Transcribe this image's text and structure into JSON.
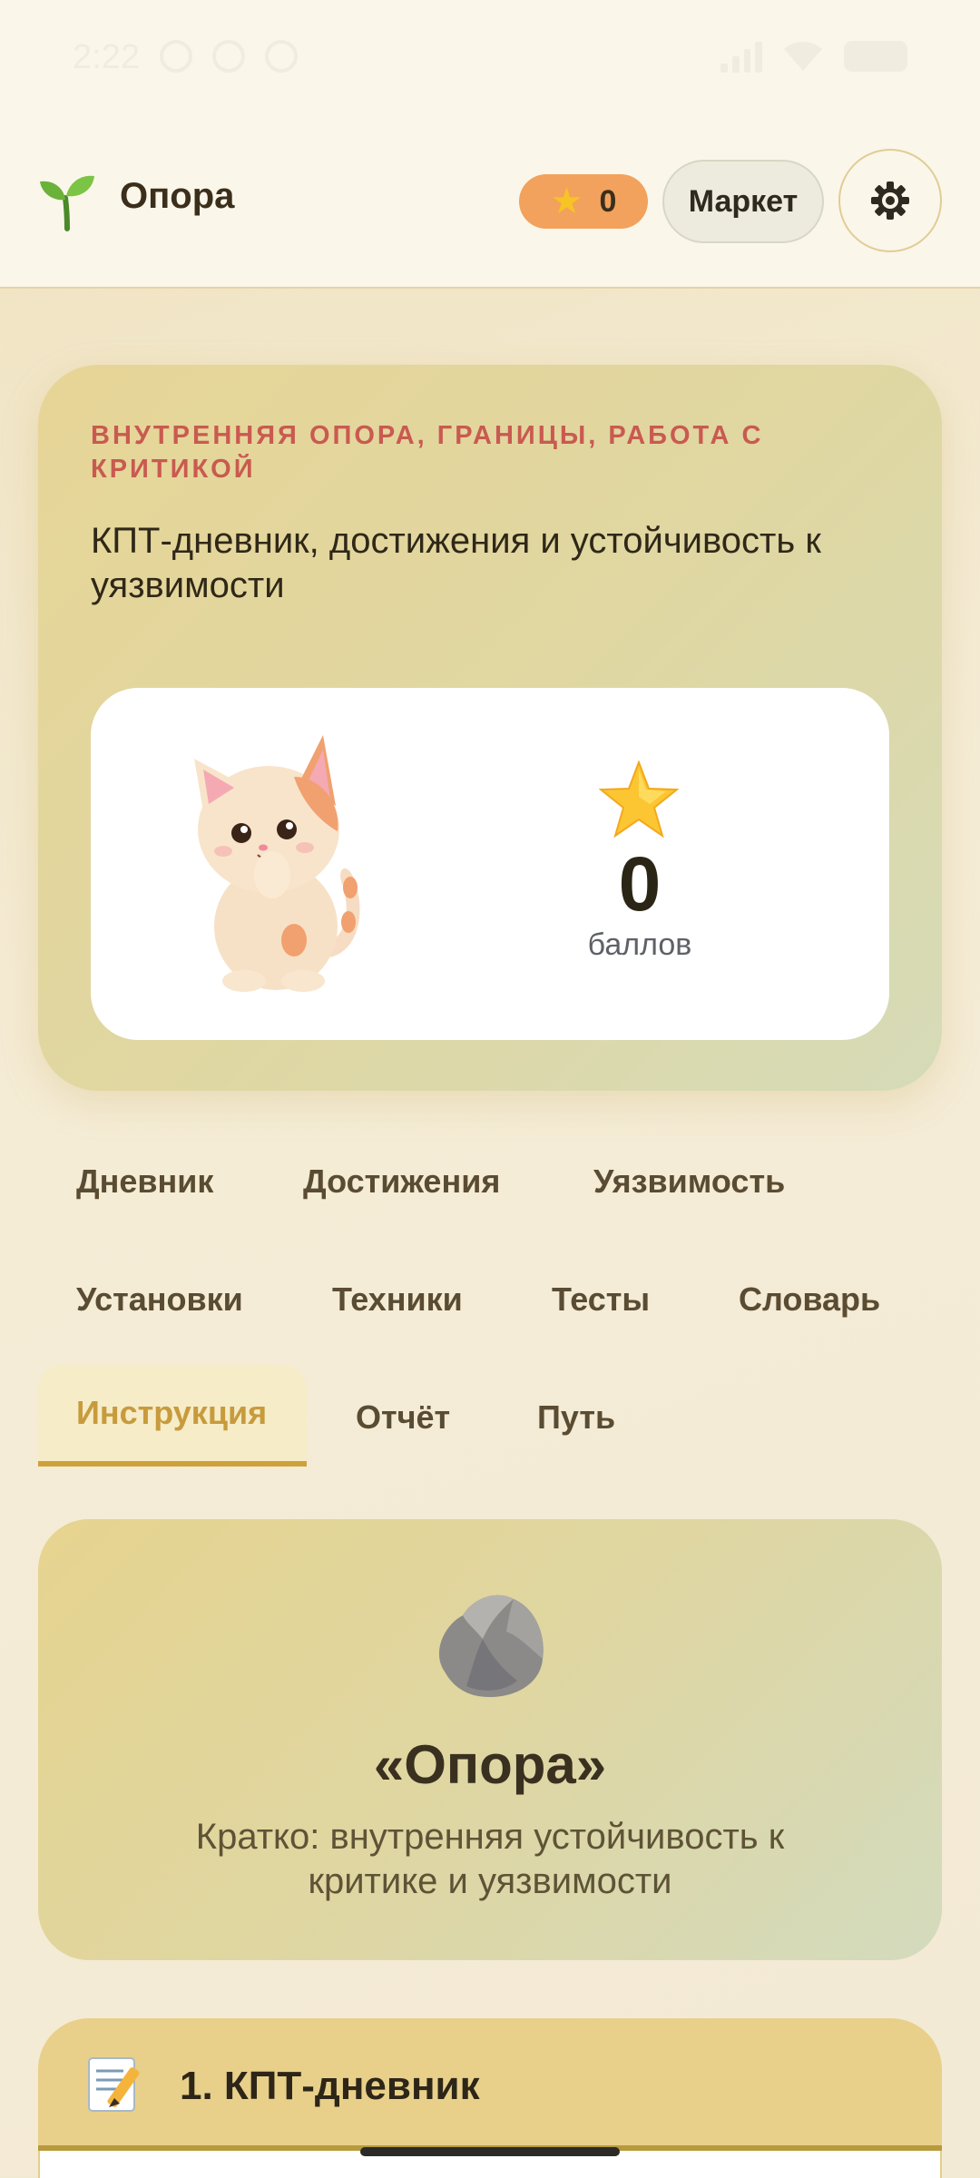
{
  "status_bar": {
    "time": "2:22"
  },
  "header": {
    "app_title": "Опора",
    "logo_icon": "sprout-icon",
    "stars_count": "0",
    "market_label": "Маркет",
    "settings_icon": "gear-icon"
  },
  "hero": {
    "kicker": "ВНУТРЕННЯЯ ОПОРА, ГРАНИЦЫ, РАБОТА С КРИТИКОЙ",
    "subtitle": "КПТ-дневник, достижения и устойчивость к уязвимости",
    "score_value": "0",
    "score_label": "баллов"
  },
  "tabs": [
    {
      "label": "Дневник",
      "active": false
    },
    {
      "label": "Достижения",
      "active": false
    },
    {
      "label": "Уязвимость",
      "active": false
    },
    {
      "label": "Установки",
      "active": false
    },
    {
      "label": "Техники",
      "active": false
    },
    {
      "label": "Тесты",
      "active": false
    },
    {
      "label": "Словарь",
      "active": false
    },
    {
      "label": "Инструкция",
      "active": true
    },
    {
      "label": "Отчёт",
      "active": false
    },
    {
      "label": "Путь",
      "active": false
    }
  ],
  "info_card": {
    "title": "«Опора»",
    "text": "Кратко: внутренняя устойчивость к критике и уязвимости"
  },
  "section": {
    "title": "1. КПТ-дневник"
  },
  "colors": {
    "accent_orange": "#f2a25c",
    "kicker_red": "#c95a51",
    "active_tab": "#c79b3c"
  }
}
